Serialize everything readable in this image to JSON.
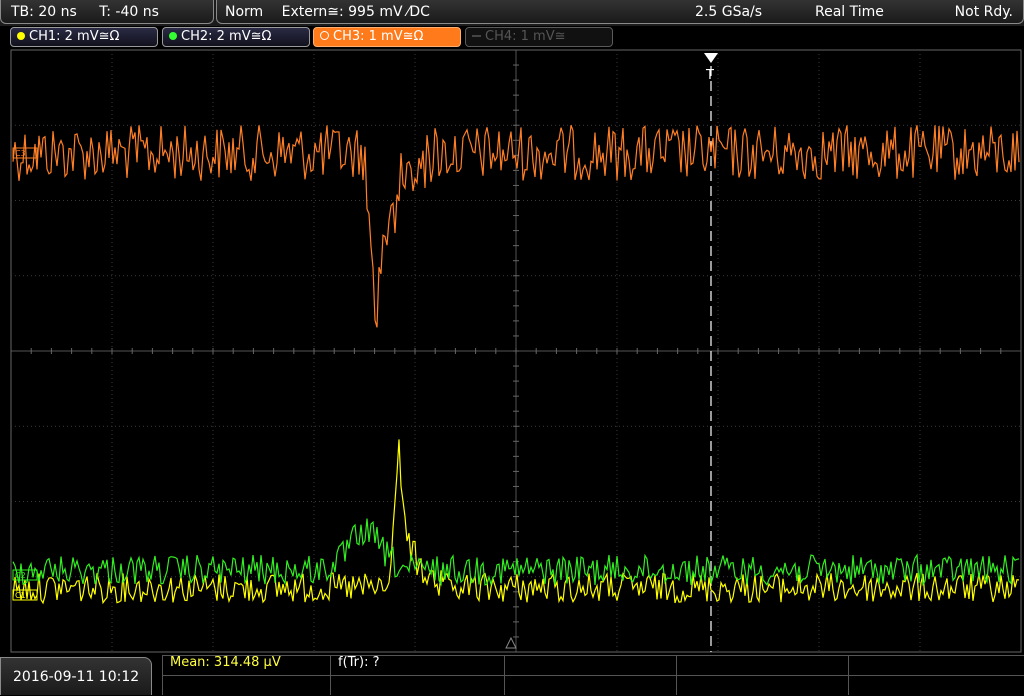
{
  "topbar": {
    "timebase": "TB: 20 ns",
    "trigger_time": "T: -40 ns",
    "trigger_mode": "Norm",
    "trigger_source": "Extern≅: 995 mV ⁄DC",
    "sample_rate": "2.5 GSa/s",
    "acq_mode": "Real Time",
    "status": "Not Rdy."
  },
  "channels": [
    {
      "label": "CH1: 2 mV≅Ω",
      "color": "#ffff00",
      "active": true
    },
    {
      "label": "CH2: 2 mV≅Ω",
      "color": "#33ff33",
      "active": true
    },
    {
      "label": "CH3: 1 mV≅Ω",
      "color": "#ff8c2a",
      "active": true,
      "selected": true
    },
    {
      "label": "CH4: 1 mV≅",
      "color": "#555555",
      "active": false
    }
  ],
  "markers": {
    "trigger": "T",
    "ch3": "C3",
    "ch2": "C2",
    "ch1": "C1"
  },
  "bottombar": {
    "datetime": "2016-09-11 10:12",
    "mean": "Mean: 314.48 µV",
    "ftr": "f(Tr): ?"
  },
  "colors": {
    "ch1": "#ffff00",
    "ch2": "#33ee22",
    "ch3": "#ff7f27",
    "grid": "#444444"
  },
  "icons": {
    "trigger-marker": "down-triangle",
    "ground-ref": "up-triangle"
  }
}
